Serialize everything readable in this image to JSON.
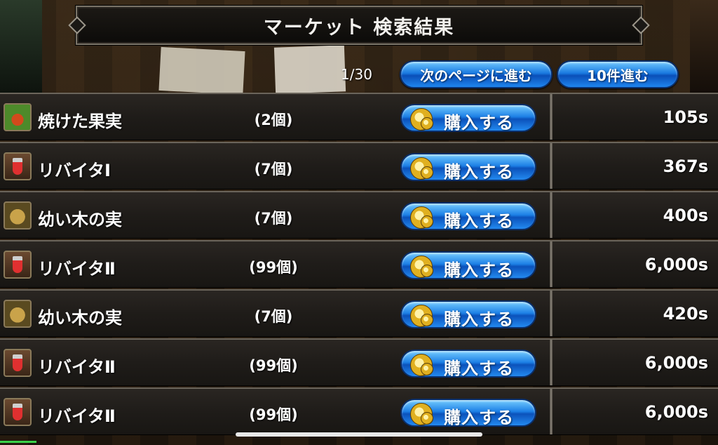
{
  "header": {
    "title": "マーケット 検索結果"
  },
  "pager": {
    "text": "1/30",
    "next_label": "次のページに進む",
    "skip_label": "10件進む"
  },
  "buy_label": "購入する",
  "rows": [
    {
      "icon": "roasted-fruit-icon",
      "name": "焼けた果実",
      "qty": "(2個)",
      "price": "105s"
    },
    {
      "icon": "potion-icon",
      "name": "リバイタⅠ",
      "qty": "(7個)",
      "price": "367s"
    },
    {
      "icon": "nut-icon",
      "name": "幼い木の実",
      "qty": "(7個)",
      "price": "400s"
    },
    {
      "icon": "potion-icon",
      "name": "リバイタⅡ",
      "qty": "(99個)",
      "price": "6,000s"
    },
    {
      "icon": "nut-icon",
      "name": "幼い木の実",
      "qty": "(7個)",
      "price": "420s"
    },
    {
      "icon": "potion-icon",
      "name": "リバイタⅡ",
      "qty": "(99個)",
      "price": "6,000s"
    },
    {
      "icon": "potion-icon",
      "name": "リバイタⅡ",
      "qty": "(99個)",
      "price": "6,000s"
    }
  ]
}
